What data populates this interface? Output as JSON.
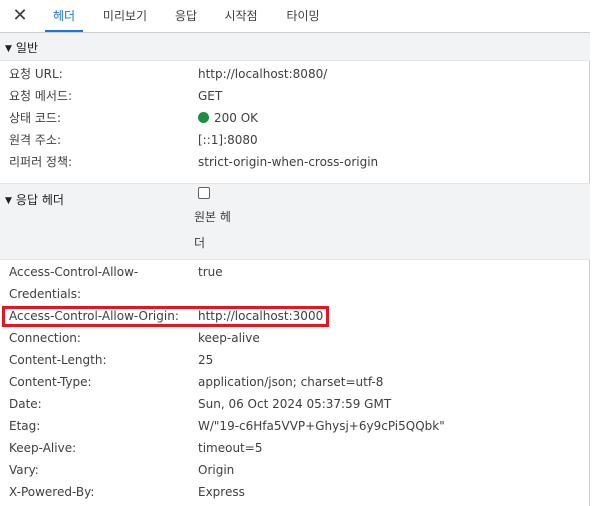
{
  "tabs": {
    "close": "✕",
    "items": [
      {
        "label": "헤더"
      },
      {
        "label": "미리보기"
      },
      {
        "label": "응답"
      },
      {
        "label": "시작점"
      },
      {
        "label": "타이밍"
      }
    ]
  },
  "general": {
    "title": "일반",
    "rows": [
      {
        "key": "요청 URL:",
        "value": "http://localhost:8080/"
      },
      {
        "key": "요청 메서드:",
        "value": "GET"
      },
      {
        "key": "상태 코드:",
        "value": "200 OK"
      },
      {
        "key": "원격 주소:",
        "value": "[::1]:8080"
      },
      {
        "key": "리퍼러 정책:",
        "value": "strict-origin-when-cross-origin"
      }
    ]
  },
  "response_headers": {
    "title": "응답 헤더",
    "raw_label_line1": "원본 헤",
    "raw_label_line2": "더",
    "rows": [
      {
        "key": "Access-Control-Allow-",
        "key2": "Credentials:",
        "value": "true"
      },
      {
        "key": "Access-Control-Allow-Origin:",
        "value": "http://localhost:3000"
      },
      {
        "key": "Connection:",
        "value": "keep-alive"
      },
      {
        "key": "Content-Length:",
        "value": "25"
      },
      {
        "key": "Content-Type:",
        "value": "application/json; charset=utf-8"
      },
      {
        "key": "Date:",
        "value": "Sun, 06 Oct 2024 05:37:59 GMT"
      },
      {
        "key": "Etag:",
        "value": "W/\"19-c6Hfa5VVP+Ghysj+6y9cPi5QQbk\""
      },
      {
        "key": "Keep-Alive:",
        "value": "timeout=5"
      },
      {
        "key": "Vary:",
        "value": "Origin"
      },
      {
        "key": "X-Powered-By:",
        "value": "Express"
      }
    ]
  },
  "colors": {
    "accent": "#1a73e8",
    "status_ok": "#1e8e3e",
    "highlight": "#e8141f"
  }
}
